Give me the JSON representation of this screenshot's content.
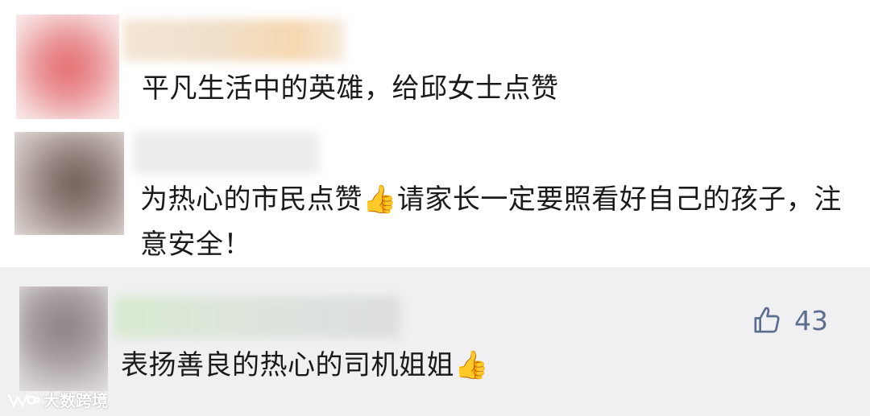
{
  "comments": [
    {
      "text": "平凡生活中的英雄，给邱女士点赞"
    },
    {
      "text_before": "为热心的市民点赞",
      "emoji": "👍",
      "text_after": "请家长一定要照看好自己的孩子，注意安全！"
    },
    {
      "text": "表扬善良的热心的司机姐姐",
      "emoji": "👍",
      "likes": "43"
    }
  ],
  "watermark": {
    "text": "大数跨境"
  },
  "colors": {
    "text": "#1a1a1a",
    "like": "#5b6e8f",
    "highlight_bg": "#f0f0f2"
  },
  "icons": {
    "like": "thumbs-up-outline-icon",
    "watermark_logo": "wechat-channel-logo-icon"
  }
}
